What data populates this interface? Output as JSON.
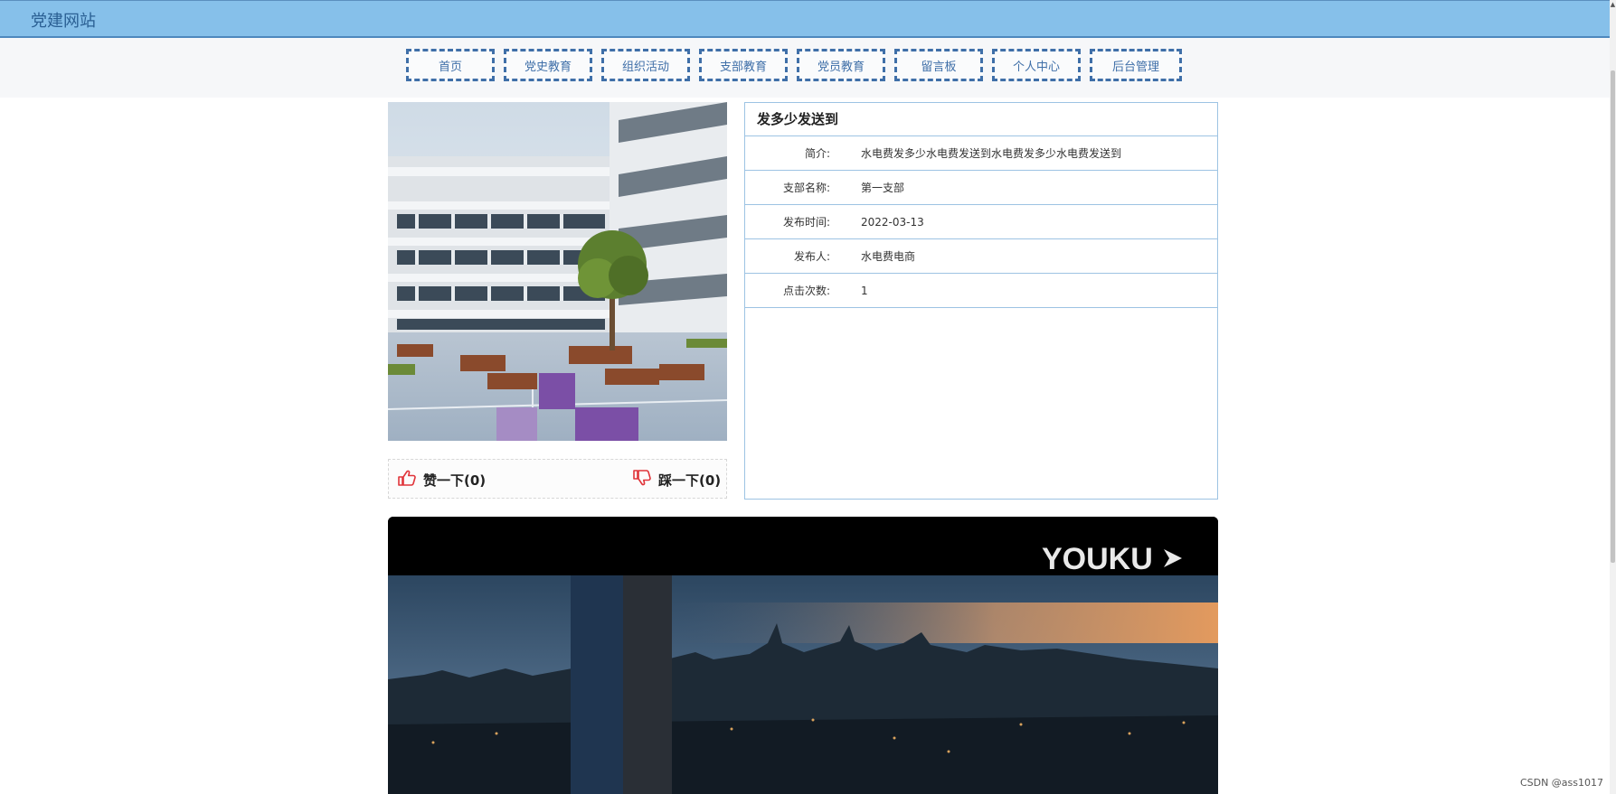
{
  "site": {
    "title": "党建网站"
  },
  "nav": [
    "首页",
    "党史教育",
    "组织活动",
    "支部教育",
    "党员教育",
    "留言板",
    "个人中心",
    "后台管理"
  ],
  "detail": {
    "title": "发多少发送到",
    "rows": [
      {
        "label": "简介:",
        "value": "水电费发多少水电费发送到水电费发多少水电费发送到"
      },
      {
        "label": "支部名称:",
        "value": "第一支部"
      },
      {
        "label": "发布时间:",
        "value": "2022-03-13"
      },
      {
        "label": "发布人:",
        "value": "水电费电商"
      },
      {
        "label": "点击次数:",
        "value": "1"
      }
    ]
  },
  "votes": {
    "like_label": "赞一下(0)",
    "dislike_label": "踩一下(0)"
  },
  "video": {
    "brand": "YOUKU"
  },
  "watermark": "CSDN @ass1017",
  "colors": {
    "header_bg": "#86c0ea",
    "nav_border": "#3f6fa8",
    "panel_border": "#9dc3e3",
    "vote_icon": "#e0343a"
  },
  "icons": {
    "like": "thumbs-up-icon",
    "dislike": "thumbs-down-icon"
  }
}
